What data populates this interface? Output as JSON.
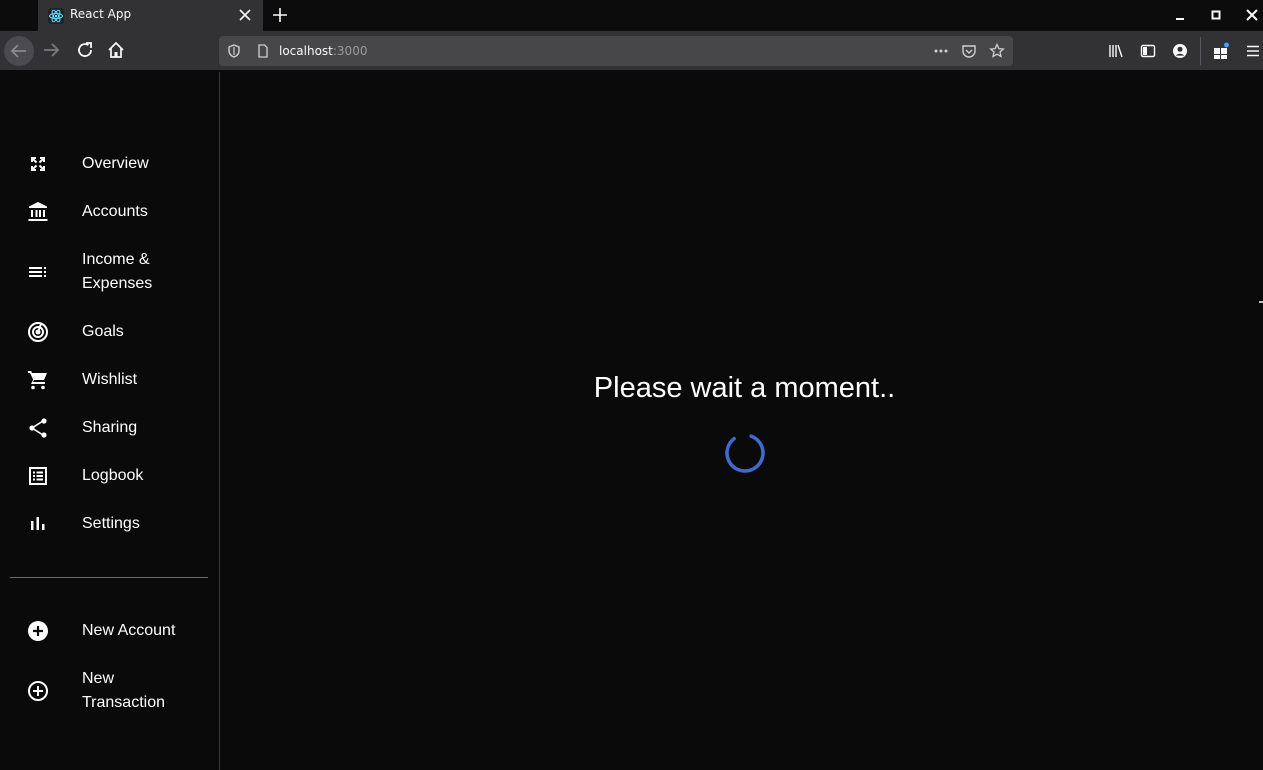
{
  "browser": {
    "tab_title": "React App",
    "url_host": "localhost",
    "url_port": ":3000"
  },
  "sidebar": {
    "items": [
      {
        "label": "Overview",
        "icon": "fullscreen-icon"
      },
      {
        "label": "Accounts",
        "icon": "bank-icon"
      },
      {
        "label": "Income & Expenses",
        "icon": "list-icon"
      },
      {
        "label": "Goals",
        "icon": "target-icon"
      },
      {
        "label": "Wishlist",
        "icon": "cart-icon"
      },
      {
        "label": "Sharing",
        "icon": "share-icon"
      },
      {
        "label": "Logbook",
        "icon": "logbook-icon"
      },
      {
        "label": "Settings",
        "icon": "bar-chart-icon"
      }
    ],
    "actions": [
      {
        "label": "New Account",
        "icon": "add-circle-filled-icon"
      },
      {
        "label": "New Transaction",
        "icon": "add-circle-outline-icon"
      }
    ]
  },
  "main": {
    "message": "Please wait a moment.."
  },
  "colors": {
    "background": "#0a0a0a",
    "chrome": "#323234",
    "spinner": "#3f6bd1"
  }
}
